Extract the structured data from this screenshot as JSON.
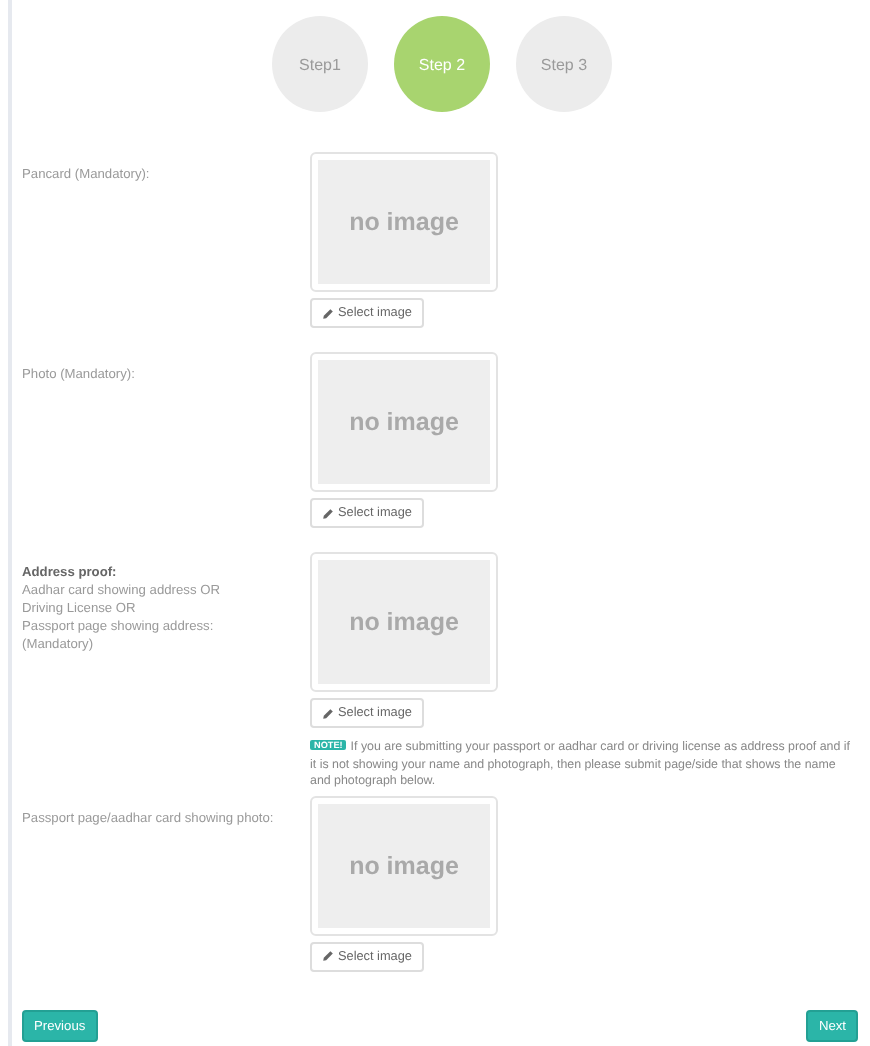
{
  "steps": [
    {
      "label": "Step1",
      "selected": false
    },
    {
      "label": "Step 2",
      "selected": true
    },
    {
      "label": "Step 3",
      "selected": false
    }
  ],
  "fields": [
    {
      "label": "Pancard (Mandatory):",
      "placeholder": "no image",
      "button": "Select image"
    },
    {
      "label": "Photo (Mandatory):",
      "placeholder": "no image",
      "button": "Select image"
    },
    {
      "title": "Address proof:",
      "lines": [
        "Aadhar card showing address OR",
        "Driving License OR",
        "Passport page showing address:",
        "(Mandatory)"
      ],
      "placeholder": "no image",
      "button": "Select image",
      "note": {
        "badge": "NOTE!",
        "text": "If you are submitting your passport or aadhar card or driving license as address proof and if it is not showing your name and photograph, then please submit page/side that shows the name and photograph below."
      }
    },
    {
      "label": "Passport page/aadhar card showing photo:",
      "placeholder": "no image",
      "button": "Select image"
    }
  ],
  "buttons": {
    "previous": "Previous",
    "next": "Next"
  }
}
